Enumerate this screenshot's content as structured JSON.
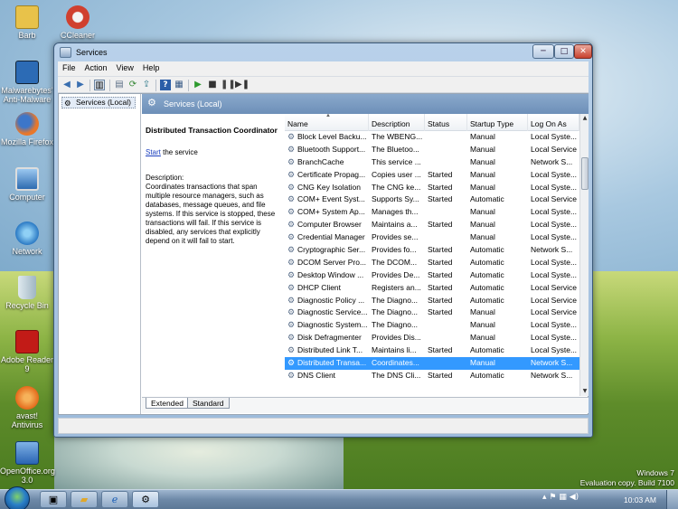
{
  "desktop": {
    "icons": [
      {
        "label": "Barb",
        "icon": "folder-icon",
        "color": "#e8c24a"
      },
      {
        "label": "CCleaner",
        "icon": "ccleaner-icon",
        "color": "#d0402f"
      },
      {
        "label": "Malwarebytes' Anti-Malware",
        "icon": "malwarebytes-icon",
        "color": "#2c6bb5"
      },
      {
        "label": "Mozilla Firefox",
        "icon": "firefox-icon",
        "color": "#e8772a"
      },
      {
        "label": "Computer",
        "icon": "computer-icon",
        "color": "#3a7cc4"
      },
      {
        "label": "Network",
        "icon": "network-icon",
        "color": "#3a8ad4"
      },
      {
        "label": "Recycle Bin",
        "icon": "recycle-bin-icon",
        "color": "#bcd0dc"
      },
      {
        "label": "Adobe Reader 9",
        "icon": "adobe-reader-icon",
        "color": "#c21b17"
      },
      {
        "label": "avast! Antivirus",
        "icon": "avast-icon",
        "color": "#e46a1b"
      },
      {
        "label": "OpenOffice.org 3.0",
        "icon": "openoffice-icon",
        "color": "#2a64b3"
      }
    ],
    "watermark": {
      "line1": "Windows 7",
      "line2": "Evaluation copy. Build 7100"
    }
  },
  "window": {
    "title": "Services",
    "caption": {
      "minimize": "─",
      "maximize": "□",
      "close": "✕"
    },
    "menu": [
      "File",
      "Action",
      "View",
      "Help"
    ],
    "tree_item": "Services (Local)",
    "panel_title": "Services (Local)",
    "details": {
      "name": "Distributed Transaction Coordinator",
      "start_link": "Start",
      "start_rest": " the service",
      "desc_label": "Description:",
      "desc_text": "Coordinates transactions that span multiple resource managers, such as databases, message queues, and file systems. If this service is stopped, these transactions will fail. If this service is disabled, any services that explicitly depend on it will fail to start."
    },
    "columns": [
      "Name",
      "Description",
      "Status",
      "Startup Type",
      "Log On As"
    ],
    "rows": [
      {
        "name": "Block Level Backu...",
        "desc": "The WBENG...",
        "status": "",
        "startup": "Manual",
        "logon": "Local Syste..."
      },
      {
        "name": "Bluetooth Support...",
        "desc": "The Bluetoo...",
        "status": "",
        "startup": "Manual",
        "logon": "Local Service"
      },
      {
        "name": "BranchCache",
        "desc": "This service ...",
        "status": "",
        "startup": "Manual",
        "logon": "Network S..."
      },
      {
        "name": "Certificate Propag...",
        "desc": "Copies user ...",
        "status": "Started",
        "startup": "Manual",
        "logon": "Local Syste..."
      },
      {
        "name": "CNG Key Isolation",
        "desc": "The CNG ke...",
        "status": "Started",
        "startup": "Manual",
        "logon": "Local Syste..."
      },
      {
        "name": "COM+ Event Syst...",
        "desc": "Supports Sy...",
        "status": "Started",
        "startup": "Automatic",
        "logon": "Local Service"
      },
      {
        "name": "COM+ System Ap...",
        "desc": "Manages th...",
        "status": "",
        "startup": "Manual",
        "logon": "Local Syste..."
      },
      {
        "name": "Computer Browser",
        "desc": "Maintains a...",
        "status": "Started",
        "startup": "Manual",
        "logon": "Local Syste..."
      },
      {
        "name": "Credential Manager",
        "desc": "Provides se...",
        "status": "",
        "startup": "Manual",
        "logon": "Local Syste..."
      },
      {
        "name": "Cryptographic Ser...",
        "desc": "Provides fo...",
        "status": "Started",
        "startup": "Automatic",
        "logon": "Network S..."
      },
      {
        "name": "DCOM Server Pro...",
        "desc": "The DCOM...",
        "status": "Started",
        "startup": "Automatic",
        "logon": "Local Syste..."
      },
      {
        "name": "Desktop Window ...",
        "desc": "Provides De...",
        "status": "Started",
        "startup": "Automatic",
        "logon": "Local Syste..."
      },
      {
        "name": "DHCP Client",
        "desc": "Registers an...",
        "status": "Started",
        "startup": "Automatic",
        "logon": "Local Service"
      },
      {
        "name": "Diagnostic Policy ...",
        "desc": "The Diagno...",
        "status": "Started",
        "startup": "Automatic",
        "logon": "Local Service"
      },
      {
        "name": "Diagnostic Service...",
        "desc": "The Diagno...",
        "status": "Started",
        "startup": "Manual",
        "logon": "Local Service"
      },
      {
        "name": "Diagnostic System...",
        "desc": "The Diagno...",
        "status": "",
        "startup": "Manual",
        "logon": "Local Syste..."
      },
      {
        "name": "Disk Defragmenter",
        "desc": "Provides Dis...",
        "status": "",
        "startup": "Manual",
        "logon": "Local Syste..."
      },
      {
        "name": "Distributed Link T...",
        "desc": "Maintains li...",
        "status": "Started",
        "startup": "Automatic",
        "logon": "Local Syste..."
      },
      {
        "name": "Distributed Transa...",
        "desc": "Coordinates...",
        "status": "",
        "startup": "Manual",
        "logon": "Network S...",
        "selected": true
      },
      {
        "name": "DNS Client",
        "desc": "The DNS Cli...",
        "status": "Started",
        "startup": "Automatic",
        "logon": "Network S..."
      }
    ],
    "tabs": [
      "Extended",
      "Standard"
    ]
  },
  "taskbar": {
    "clock": "10:03 AM",
    "buttons": [
      "explorer-icon",
      "folder-icon",
      "internet-explorer-icon",
      "services-icon"
    ]
  },
  "colors": {
    "selection": "#3399ff",
    "link": "#1a3fbf",
    "panel_header": "#7b9bc2"
  }
}
